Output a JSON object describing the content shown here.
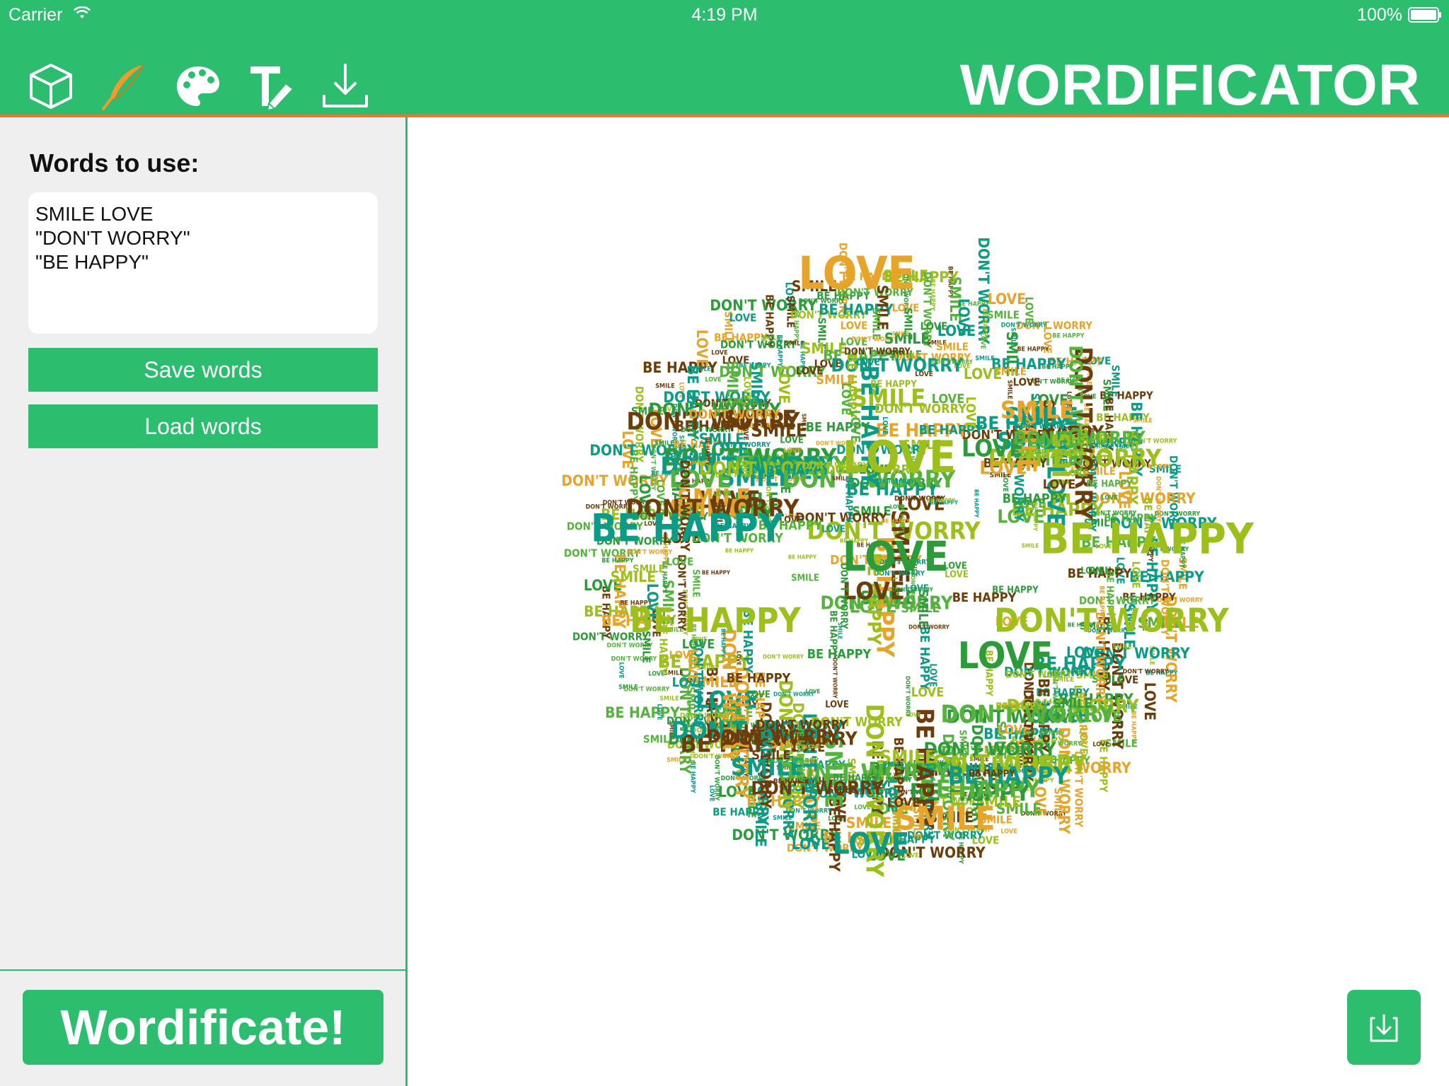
{
  "status_bar": {
    "carrier": "Carrier",
    "time": "4:19 PM",
    "battery": "100%"
  },
  "header": {
    "title": "WORDIFICATOR",
    "toolbar": [
      "cube-icon",
      "feather-icon",
      "palette-icon",
      "text-edit-icon",
      "download-icon"
    ],
    "colors": {
      "bar": "#2dbd6e",
      "underline": "#e57a2a"
    }
  },
  "sidebar": {
    "words_label": "Words to use:",
    "words_value": "SMILE LOVE\n\"DON'T WORRY\"\n\"BE HAPPY\"",
    "save_label": "Save words",
    "load_label": "Load words",
    "wordificate_label": "Wordificate!"
  },
  "canvas": {
    "download_icon": "download-icon",
    "word_cloud": {
      "shape": "smiley-face",
      "words": [
        "SMILE",
        "LOVE",
        "DON'T WORRY",
        "BE HAPPY"
      ],
      "colors": [
        "#0c9b85",
        "#9dbf1c",
        "#e6a52a",
        "#6b3d0b",
        "#55b33d",
        "#2e9b3a"
      ]
    }
  }
}
